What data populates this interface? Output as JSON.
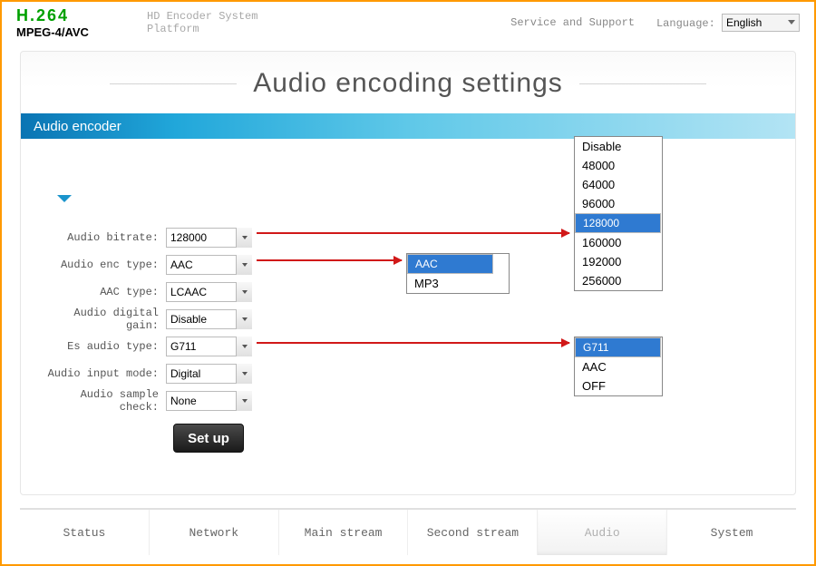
{
  "header": {
    "logo_top": "H.264",
    "logo_bottom": "MPEG-4/AVC",
    "product_line1": "HD Encoder System",
    "product_line2": "Platform",
    "service_link": "Service and Support",
    "language_label": "Language:",
    "language_value": "English"
  },
  "page": {
    "title": "Audio encoding settings",
    "section": "Audio encoder"
  },
  "form": {
    "bitrate": {
      "label": "Audio bitrate:",
      "value": "128000"
    },
    "enc_type": {
      "label": "Audio enc type:",
      "value": "AAC"
    },
    "aac_type": {
      "label": "AAC type:",
      "value": "LCAAC"
    },
    "gain": {
      "label": "Audio digital gain:",
      "value": "Disable"
    },
    "es_type": {
      "label": "Es audio type:",
      "value": "G711"
    },
    "input_mode": {
      "label": "Audio input mode:",
      "value": "Digital"
    },
    "sample_check": {
      "label": "Audio sample check:",
      "value": "None"
    },
    "setup_button": "Set up"
  },
  "dropdowns": {
    "bitrate": {
      "options": [
        "Disable",
        "48000",
        "64000",
        "96000",
        "128000",
        "160000",
        "192000",
        "256000"
      ],
      "selected": "128000"
    },
    "enc_type": {
      "options": [
        "AAC",
        "MP3"
      ],
      "selected": "AAC"
    },
    "es_type": {
      "options": [
        "G711",
        "AAC",
        "OFF"
      ],
      "selected": "G711"
    }
  },
  "tabs": [
    {
      "label": "Status",
      "active": false
    },
    {
      "label": "Network",
      "active": false
    },
    {
      "label": "Main stream",
      "active": false
    },
    {
      "label": "Second stream",
      "active": false
    },
    {
      "label": "Audio",
      "active": true
    },
    {
      "label": "System",
      "active": false
    }
  ]
}
